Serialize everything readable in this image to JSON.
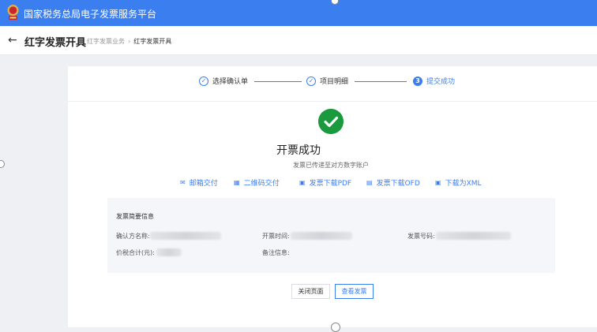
{
  "app": {
    "title": "国家税务总局电子发票服务平台"
  },
  "header": {
    "title": "红字发票开具",
    "breadcrumb": [
      "红字发票业务",
      "红字发票开具"
    ]
  },
  "steps": [
    {
      "label": "选择确认单",
      "status": "done",
      "marker": "✓"
    },
    {
      "label": "项目明细",
      "status": "done",
      "marker": "✓"
    },
    {
      "label": "提交成功",
      "status": "active",
      "marker": "3"
    }
  ],
  "result": {
    "title": "开票成功",
    "subtitle": "发票已传递至对方数字账户"
  },
  "actions": [
    {
      "label": "邮箱交付",
      "icon": "mail-icon"
    },
    {
      "label": "二维码交付",
      "icon": "qrcode-icon"
    },
    {
      "label": "发票下载PDF",
      "icon": "pdf-icon"
    },
    {
      "label": "发票下载OFD",
      "icon": "ofd-icon"
    },
    {
      "label": "下载为XML",
      "icon": "xml-icon"
    }
  ],
  "summary": {
    "title": "发票简要信息",
    "fields": {
      "buyer_name": "确认方名称:",
      "issue_time": "开票时间:",
      "invoice_no": "发票号码:",
      "total_amount": "价税合计(元):",
      "remarks": "备注信息:"
    }
  },
  "buttons": {
    "close": "关闭页面",
    "view": "查看发票"
  },
  "colors": {
    "brand": "#3b7ef0",
    "success": "#1a9a3c"
  }
}
